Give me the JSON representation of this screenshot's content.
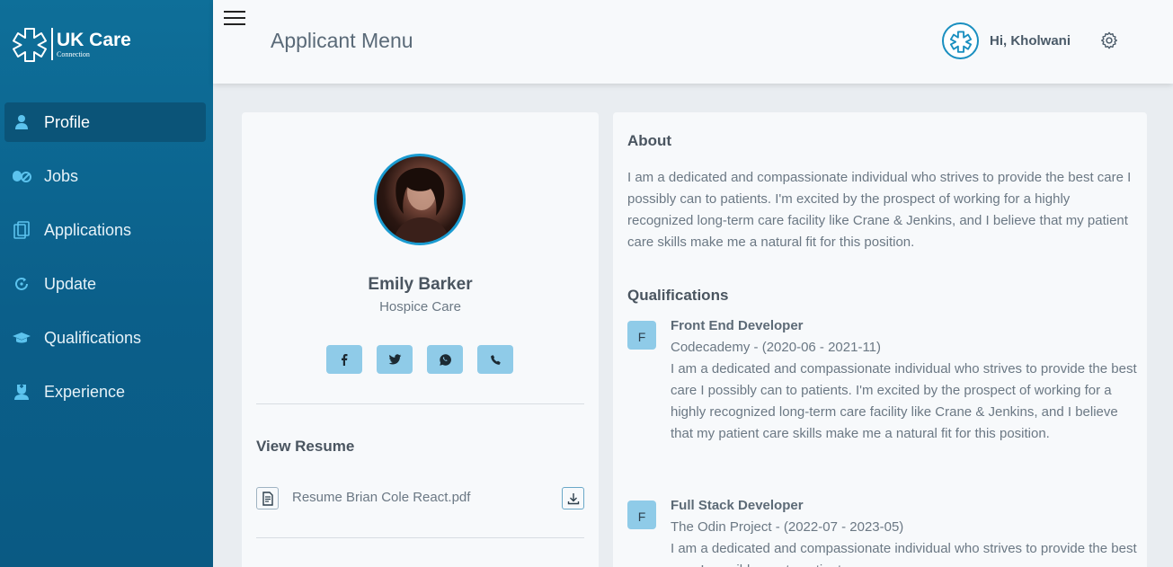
{
  "brand": {
    "title": "UK Care",
    "subtitle": "Connection",
    "icon": "medical-cross-logo"
  },
  "sidebar": {
    "items": [
      {
        "label": "Profile",
        "icon": "user-icon",
        "active": true
      },
      {
        "label": "Jobs",
        "icon": "pills-icon",
        "active": false
      },
      {
        "label": "Applications",
        "icon": "documents-icon",
        "active": false
      },
      {
        "label": "Update",
        "icon": "refresh-icon",
        "active": false
      },
      {
        "label": "Qualifications",
        "icon": "graduation-cap-icon",
        "active": false
      },
      {
        "label": "Experience",
        "icon": "nurse-icon",
        "active": false
      }
    ]
  },
  "header": {
    "title": "Applicant Menu",
    "greeting": "Hi, Kholwani"
  },
  "profile": {
    "name": "Emily Barker",
    "role": "Hospice Care",
    "socials": [
      "facebook-icon",
      "twitter-icon",
      "whatsapp-icon",
      "phone-icon"
    ],
    "resume_heading": "View Resume",
    "resume_file": "Resume Brian Cole React.pdf"
  },
  "about": {
    "heading": "About",
    "text": "I am a dedicated and compassionate individual who strives to provide the best care I possibly can to patients. I'm excited by the prospect of working for a highly recognized long-term care facility like Crane & Jenkins, and I believe that my patient care skills make me a natural fit for this position."
  },
  "qualifications": {
    "heading": "Qualifications",
    "items": [
      {
        "badge": "F",
        "title": "Front End Developer",
        "sub": "Codecademy - (2020-06 - 2021-11)",
        "desc": "I am a dedicated and compassionate individual who strives to provide the best care I possibly can to patients. I'm excited by the prospect of working for a highly recognized long-term care facility like Crane & Jenkins, and I believe that my patient care skills make me a natural fit for this position."
      },
      {
        "badge": "F",
        "title": "Full Stack Developer",
        "sub": "The Odin Project - (2022-07 - 2023-05)",
        "desc": "I am a dedicated and compassionate individual who strives to provide the best care I possibly can to patients."
      }
    ]
  },
  "colors": {
    "sidebar": "#0b5f8a",
    "accent": "#1a9bd1",
    "badge": "#8fcbe8"
  }
}
